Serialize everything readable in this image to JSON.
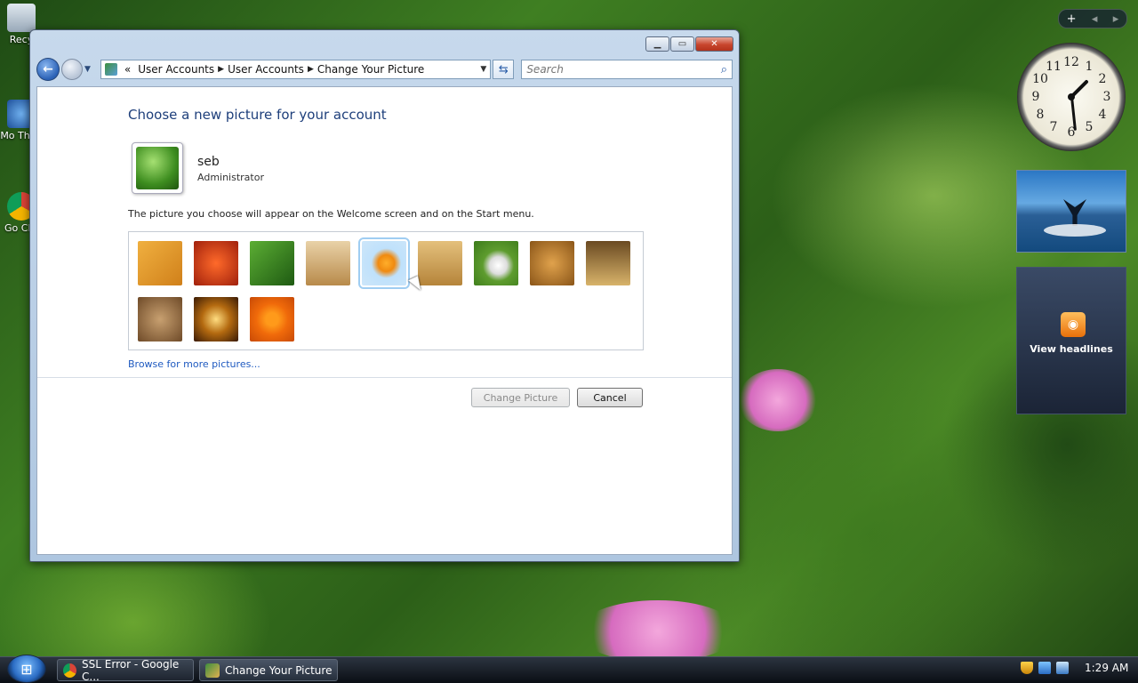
{
  "desktop": {
    "icons": [
      {
        "label": "Recy"
      },
      {
        "label": "Mo Thun"
      },
      {
        "label": "Go Chr"
      }
    ]
  },
  "window": {
    "address": {
      "prefix": "«",
      "segments": [
        "User Accounts",
        "User Accounts",
        "Change Your Picture"
      ]
    },
    "search_placeholder": "Search",
    "heading": "Choose a new picture for your account",
    "user": {
      "name": "seb",
      "role": "Administrator"
    },
    "description": "The picture you choose will appear on the Welcome screen and on the Start menu.",
    "pictures": [
      {
        "name": "bass-clef",
        "selected": false
      },
      {
        "name": "autumn-leaves",
        "selected": false
      },
      {
        "name": "green-leaf",
        "selected": false
      },
      {
        "name": "robot",
        "selected": false
      },
      {
        "name": "goldfish",
        "selected": true
      },
      {
        "name": "bonsai",
        "selected": false
      },
      {
        "name": "soccer-ball",
        "selected": false
      },
      {
        "name": "dog",
        "selected": false
      },
      {
        "name": "chess",
        "selected": false
      },
      {
        "name": "kitten",
        "selected": false
      },
      {
        "name": "sparkles",
        "selected": false
      },
      {
        "name": "orange-flower",
        "selected": false
      }
    ],
    "browse_link": "Browse for more pictures...",
    "change_button": "Change Picture",
    "cancel_button": "Cancel"
  },
  "sidebar": {
    "feed_label": "View headlines"
  },
  "taskbar": {
    "tasks": [
      "SSL Error - Google C...",
      "Change Your Picture"
    ],
    "time": "1:29 AM"
  },
  "colors": {
    "accent": "#1e3f7b",
    "link": "#1f5ac0",
    "close": "#c8452d"
  }
}
